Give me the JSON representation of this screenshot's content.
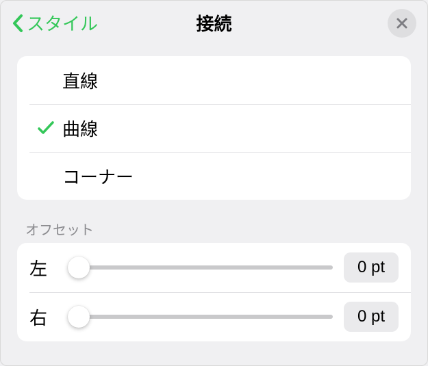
{
  "header": {
    "back_label": "スタイル",
    "title": "接続"
  },
  "line_types": {
    "items": [
      {
        "label": "直線",
        "selected": false
      },
      {
        "label": "曲線",
        "selected": true
      },
      {
        "label": "コーナー",
        "selected": false
      }
    ]
  },
  "offset": {
    "section_label": "オフセット",
    "left_label": "左",
    "right_label": "右",
    "left_value": "0 pt",
    "right_value": "0 pt"
  }
}
